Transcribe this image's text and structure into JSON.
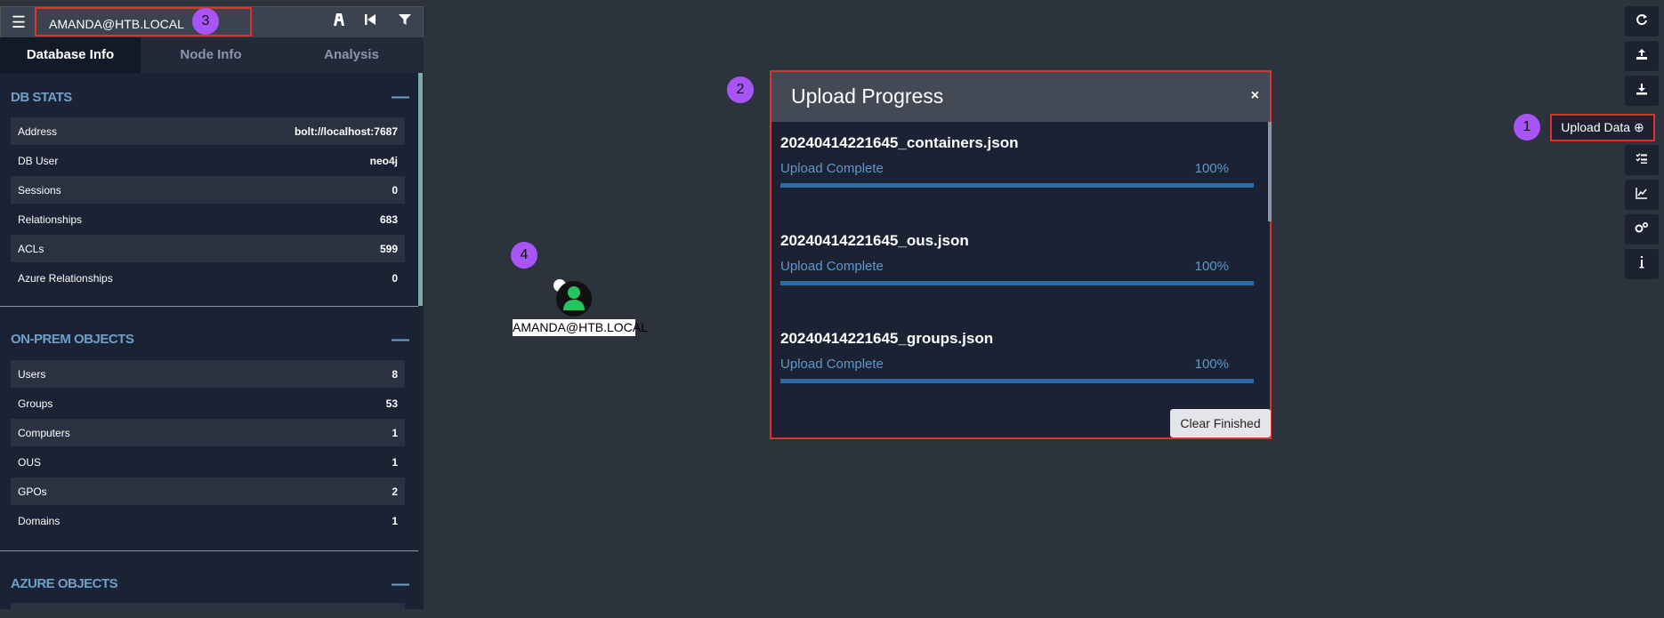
{
  "search": {
    "value": "AMANDA@HTB.LOCAL"
  },
  "markers": {
    "m1": "1",
    "m2": "2",
    "m3": "3",
    "m4": "4"
  },
  "tabs": [
    {
      "label": "Database Info",
      "active": true
    },
    {
      "label": "Node Info",
      "active": false
    },
    {
      "label": "Analysis",
      "active": false
    }
  ],
  "db_stats": {
    "title": "DB STATS",
    "rows": [
      {
        "label": "Address",
        "value": "bolt://localhost:7687"
      },
      {
        "label": "DB User",
        "value": "neo4j"
      },
      {
        "label": "Sessions",
        "value": "0"
      },
      {
        "label": "Relationships",
        "value": "683"
      },
      {
        "label": "ACLs",
        "value": "599"
      },
      {
        "label": "Azure Relationships",
        "value": "0"
      }
    ]
  },
  "onprem": {
    "title": "ON-PREM OBJECTS",
    "rows": [
      {
        "label": "Users",
        "value": "8"
      },
      {
        "label": "Groups",
        "value": "53"
      },
      {
        "label": "Computers",
        "value": "1"
      },
      {
        "label": "OUS",
        "value": "1"
      },
      {
        "label": "GPOs",
        "value": "2"
      },
      {
        "label": "Domains",
        "value": "1"
      }
    ]
  },
  "azure": {
    "title": "AZURE OBJECTS"
  },
  "upload_button": {
    "label": "Upload Data"
  },
  "modal": {
    "title": "Upload Progress",
    "close": "×",
    "items": [
      {
        "name": "20240414221645_containers.json",
        "status": "Upload Complete",
        "percent": "100%",
        "progress": 1.0
      },
      {
        "name": "20240414221645_ous.json",
        "status": "Upload Complete",
        "percent": "100%",
        "progress": 1.0
      },
      {
        "name": "20240414221645_groups.json",
        "status": "Upload Complete",
        "percent": "100%",
        "progress": 1.0
      }
    ],
    "clear_label": "Clear Finished"
  },
  "node": {
    "label": "AMANDA@HTB.LOCAL"
  },
  "colors": {
    "accent": "#a855f7",
    "highlight": "#e0312b",
    "section": "#6fa0c8",
    "progress": "#2e6aa3",
    "node_user": "#22c55e"
  }
}
